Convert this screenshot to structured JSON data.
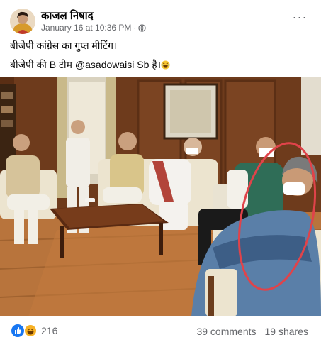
{
  "post": {
    "author": "काजल निषाद",
    "timestamp": "January 16 at 10:36 PM",
    "separator": "·",
    "privacy_icon": "globe-icon",
    "more_icon": "more-options-icon",
    "more_label": "···",
    "text_line1": "बीजेपी कांग्रेस का गुप्त मीटिंग।",
    "text_line2": "बीजेपी की B टीम @asadowaisi Sb है।",
    "photo_icon": "meeting-photo",
    "highlight_color": "#e0434a"
  },
  "footer": {
    "reaction_icons": [
      "like-icon",
      "haha-icon"
    ],
    "reaction_count": "216",
    "comments": "39 comments",
    "shares": "19 shares",
    "like_color": "#1877f2",
    "haha_color": "#f7b125"
  }
}
